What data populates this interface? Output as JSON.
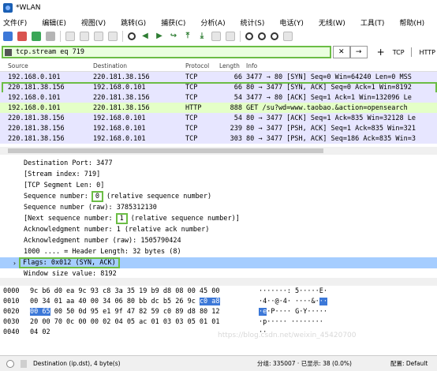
{
  "window": {
    "title": "*WLAN"
  },
  "menu": [
    "文件(F)",
    "编辑(E)",
    "视图(V)",
    "跳转(G)",
    "捕获(C)",
    "分析(A)",
    "统计(S)",
    "电话(Y)",
    "无线(W)",
    "工具(T)",
    "帮助(H)"
  ],
  "toolbar": {
    "icons": [
      "shark-fin-icon",
      "stop-icon",
      "restart-icon",
      "options-icon",
      "open-icon",
      "save-icon",
      "close-file-icon",
      "reload-icon",
      "find-icon",
      "back-icon",
      "forward-icon",
      "goto-icon",
      "first-icon",
      "last-icon",
      "autoscroll-icon",
      "colorize-icon",
      "zoom-in-icon",
      "zoom-out-icon",
      "zoom-reset-icon",
      "resize-columns-icon"
    ]
  },
  "filter": {
    "value": "tcp.stream eq 719",
    "clear_label": "✕",
    "apply_label": "→",
    "add_label": "+",
    "btn_tcp": "TCP",
    "btn_http": "HTTP"
  },
  "packet_list": {
    "columns": [
      "Source",
      "Destination",
      "Protocol",
      "Length",
      "Info"
    ],
    "rows": [
      {
        "src": "192.168.0.101",
        "dst": "220.181.38.156",
        "proto": "TCP",
        "len": "66",
        "info": "3477 → 80 [SYN] Seq=0 Win=64240 Len=0 MSS",
        "kind": "tcp"
      },
      {
        "src": "220.181.38.156",
        "dst": "192.168.0.101",
        "proto": "TCP",
        "len": "66",
        "info": "80 → 3477 [SYN, ACK] Seq=0 Ack=1 Win=8192",
        "kind": "selected"
      },
      {
        "src": "192.168.0.101",
        "dst": "220.181.38.156",
        "proto": "TCP",
        "len": "54",
        "info": "3477 → 80 [ACK] Seq=1 Ack=1 Win=132096 Le",
        "kind": "tcp"
      },
      {
        "src": "192.168.0.101",
        "dst": "220.181.38.156",
        "proto": "HTTP",
        "len": "888",
        "info": "GET /su?wd=www.taobao.&action=opensearch",
        "kind": "http"
      },
      {
        "src": "220.181.38.156",
        "dst": "192.168.0.101",
        "proto": "TCP",
        "len": "54",
        "info": "80 → 3477 [ACK] Seq=1 Ack=835 Win=32128 Le",
        "kind": "tcp"
      },
      {
        "src": "220.181.38.156",
        "dst": "192.168.0.101",
        "proto": "TCP",
        "len": "239",
        "info": "80 → 3477 [PSH, ACK] Seq=1 Ack=835 Win=321",
        "kind": "tcp"
      },
      {
        "src": "220.181.38.156",
        "dst": "192.168.0.101",
        "proto": "TCP",
        "len": "303",
        "info": "80 → 3477 [PSH, ACK] Seq=186 Ack=835 Win=3",
        "kind": "tcp"
      }
    ]
  },
  "details": {
    "dst_port": "Destination Port: 3477",
    "stream_index": "[Stream index: 719]",
    "segment_len": "[TCP Segment Len: 0]",
    "seq_prefix": "Sequence number:",
    "seq_value": "0",
    "seq_suffix": "(relative sequence number)",
    "seq_raw": "Sequence number (raw): 3785312130",
    "next_seq_prefix": "[Next sequence number:",
    "next_seq_value": "1",
    "next_seq_suffix": "(relative sequence number)]",
    "ack": "Acknowledgment number: 1    (relative ack number)",
    "ack_raw": "Acknowledgment number (raw): 1505790424",
    "header_len": "1000 .... = Header Length: 32 bytes (8)",
    "flags": "Flags: 0x012 (SYN, ACK)",
    "window": "Window size value: 8192"
  },
  "hex": [
    {
      "off": "0000",
      "pre": "9c b6 d0 ea 9c 93 c8 3a  35 19 b9 d8 08 00 45 00",
      "hl": "",
      "post": "",
      "ascii_pre": "·······: 5·····E·",
      "ascii_hl": "",
      "ascii_post": ""
    },
    {
      "off": "0010",
      "pre": "00 34 01 aa 40 00 34 06  80 bb dc b5 26 9c ",
      "hl": "c0 a8",
      "post": "",
      "ascii_pre": "·4··@·4· ····&·",
      "ascii_hl": "··",
      "ascii_post": ""
    },
    {
      "off": "0020",
      "pre": "",
      "hl": "00 65",
      "post": " 00 50 0d 95 e1 9f  47 82 59 c0 89 d8 80 12",
      "ascii_pre": "",
      "ascii_hl": "·e",
      "ascii_post": "·P···· G·Y·····"
    },
    {
      "off": "0030",
      "pre": "20 00 70 0c 00 00 02 04  05 ac 01 03 03 05 01 01",
      "hl": "",
      "post": "",
      "ascii_pre": " ·p····· ········",
      "ascii_hl": "",
      "ascii_post": ""
    },
    {
      "off": "0040",
      "pre": "04 02",
      "hl": "",
      "post": "",
      "ascii_pre": "··",
      "ascii_hl": "",
      "ascii_post": ""
    }
  ],
  "status": {
    "field": "Destination (ip.dst), 4 byte(s)",
    "stats": "分组: 335007 · 已显示: 38 (0.0%)",
    "profile": "配置: Default"
  },
  "watermark": "https://blog.csdn.net/weixin_45420700"
}
